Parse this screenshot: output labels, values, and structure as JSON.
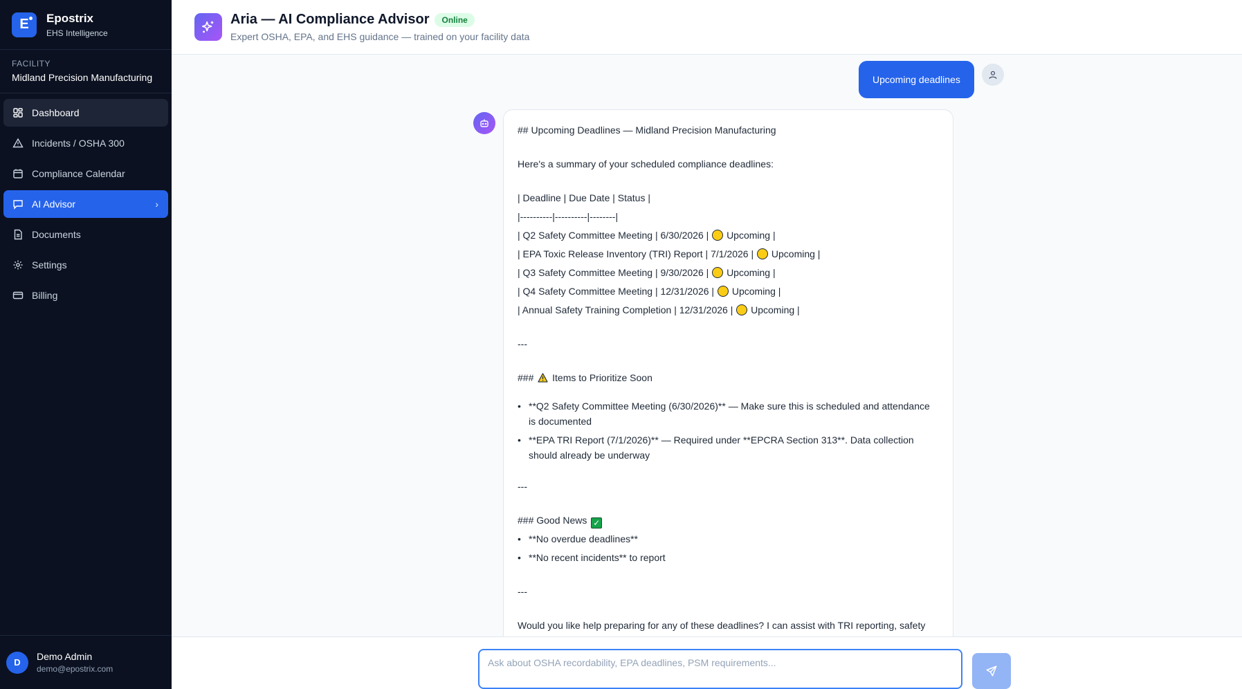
{
  "brand": {
    "name": "Epostrix",
    "subtitle": "EHS Intelligence",
    "logo_letter": "E"
  },
  "facility": {
    "label": "FACILITY",
    "name": "Midland Precision Manufacturing"
  },
  "nav": [
    {
      "label": "Dashboard",
      "icon": "grid-icon",
      "state": "hover"
    },
    {
      "label": "Incidents / OSHA 300",
      "icon": "warning-icon"
    },
    {
      "label": "Compliance Calendar",
      "icon": "calendar-icon"
    },
    {
      "label": "AI Advisor",
      "icon": "chat-icon",
      "state": "active"
    },
    {
      "label": "Documents",
      "icon": "document-icon"
    },
    {
      "label": "Settings",
      "icon": "gear-icon"
    },
    {
      "label": "Billing",
      "icon": "card-icon"
    }
  ],
  "user": {
    "initial": "D",
    "name": "Demo Admin",
    "email": "demo@epostrix.com"
  },
  "header": {
    "title": "Aria — AI Compliance Advisor",
    "status": "Online",
    "subtitle": "Expert OSHA, EPA, and EHS guidance — trained on your facility data"
  },
  "chat": {
    "user_message": "Upcoming deadlines",
    "bot": {
      "heading": "## Upcoming Deadlines — Midland Precision Manufacturing",
      "intro": "Here's a summary of your scheduled compliance deadlines:",
      "table_header": "| Deadline | Due Date | Status |",
      "table_sep": "|----------|----------|--------|",
      "rows": [
        {
          "pre": "| Q2 Safety Committee Meeting | 6/30/2026 |",
          "post": "Upcoming |"
        },
        {
          "pre": "| EPA Toxic Release Inventory (TRI) Report | 7/1/2026 |",
          "post": "Upcoming |"
        },
        {
          "pre": "| Q3 Safety Committee Meeting | 9/30/2026 |",
          "post": "Upcoming |"
        },
        {
          "pre": "| Q4 Safety Committee Meeting | 12/31/2026 |",
          "post": "Upcoming |"
        },
        {
          "pre": "| Annual Safety Training Completion | 12/31/2026 |",
          "post": "Upcoming |"
        }
      ],
      "hr": "---",
      "priority_prefix": "###",
      "priority_title": "Items to Prioritize Soon",
      "priority_items": [
        "**Q2 Safety Committee Meeting (6/30/2026)** — Make sure this is scheduled and attendance is documented",
        "**EPA TRI Report (7/1/2026)** — Required under **EPCRA Section 313**. Data collection should already be underway"
      ],
      "good_title": "### Good News",
      "good_items": [
        "**No overdue deadlines**",
        "**No recent incidents** to report"
      ],
      "closing": "Would you like help preparing for any of these deadlines? I can assist with TRI reporting, safety"
    }
  },
  "input": {
    "placeholder": "Ask about OSHA recordability, EPA deadlines, PSM requirements...",
    "value": ""
  },
  "colors": {
    "accent": "#2563eb",
    "sidebar": "#0b1120",
    "online": "#15803d"
  }
}
